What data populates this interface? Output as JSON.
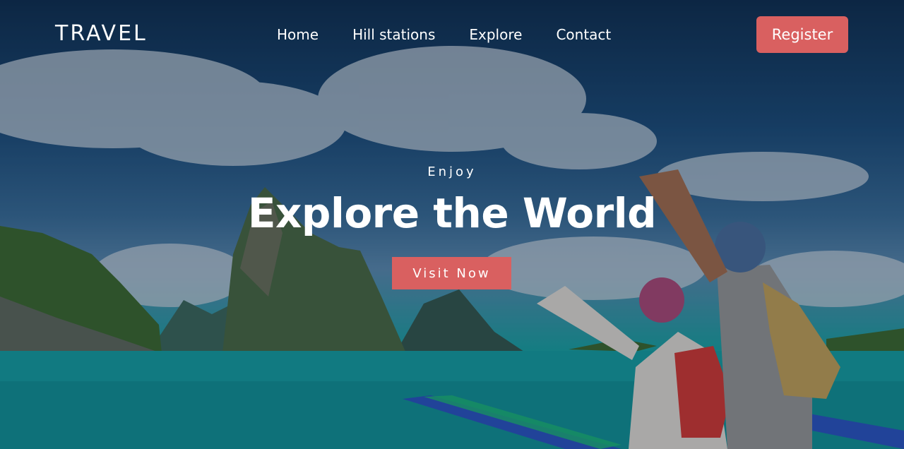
{
  "nav": {
    "logo": "TRAVEL",
    "links": [
      "Home",
      "Hill stations",
      "Explore",
      "Contact"
    ],
    "register_label": "Register"
  },
  "hero": {
    "eyebrow": "Enjoy",
    "title": "Explore the World",
    "cta_label": "Visit Now"
  },
  "colors": {
    "accent": "#d96060",
    "text": "#ffffff"
  }
}
